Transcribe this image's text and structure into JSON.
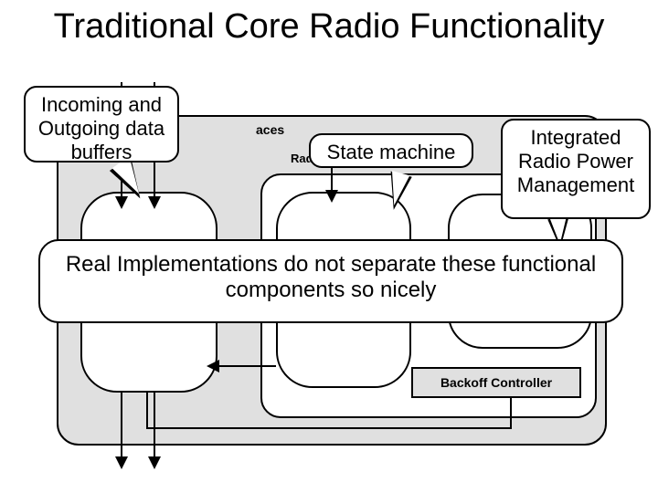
{
  "title": "Traditional Core Radio Functionality",
  "callouts": {
    "buffers": "Incoming and Outgoing data buffers",
    "state": "State machine",
    "integrated": "Integrated Radio Power Management"
  },
  "big_note": "Real Implementations do not separate these functional components so nicely",
  "labels": {
    "interfaces_fragment": "aces",
    "radio_fragment": "Rad",
    "backoff": "Backoff Controller"
  }
}
